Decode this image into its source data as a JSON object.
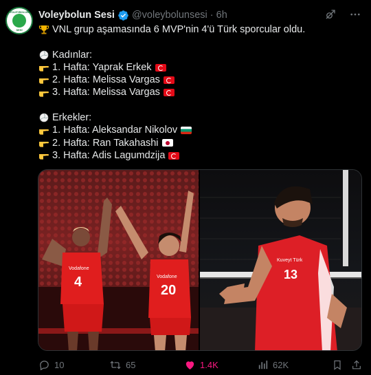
{
  "tweet": {
    "author_name": "Voleybolun Sesi",
    "handle": "@voleybolunsesi",
    "separator": "·",
    "time": "6h",
    "verified": true,
    "avatar_text": "VOLEYBOLUN SESİ",
    "lines": {
      "headline": "VNL grup aşamasında 6 MVP'nin 4'ü Türk sporcular oldu.",
      "women_header": "Kadınlar:",
      "women_1": "1. Hafta: Yaprak Erkek",
      "women_2": "2. Hafta: Melissa Vargas",
      "women_3": "3. Hafta: Melissa Vargas",
      "men_header": "Erkekler:",
      "men_1": "1. Hafta: Aleksandar Nikolov",
      "men_2": "2. Hafta: Ran Takahashi",
      "men_3": "3. Hafta: Adis Lagumdzija"
    },
    "media": {
      "left_jersey_1": "4",
      "left_jersey_2": "20",
      "left_sponsor": "Vodafone",
      "right_jersey": "13",
      "right_sponsor": "Kuveyt Türk"
    },
    "actions": {
      "replies": "10",
      "reposts": "65",
      "likes": "1.4K",
      "views": "62K"
    }
  },
  "colors": {
    "background": "#000000",
    "text": "#e7e9ea",
    "secondary": "#71767b",
    "like_active": "#f91880",
    "verified": "#1d9bf0",
    "turkey_red": "#e30a17"
  },
  "icons": [
    "grok-icon",
    "more-icon",
    "trophy-icon",
    "volleyball-icon",
    "pointing-hand-icon",
    "reply-icon",
    "repost-icon",
    "like-icon",
    "views-icon",
    "bookmark-icon",
    "share-icon"
  ]
}
